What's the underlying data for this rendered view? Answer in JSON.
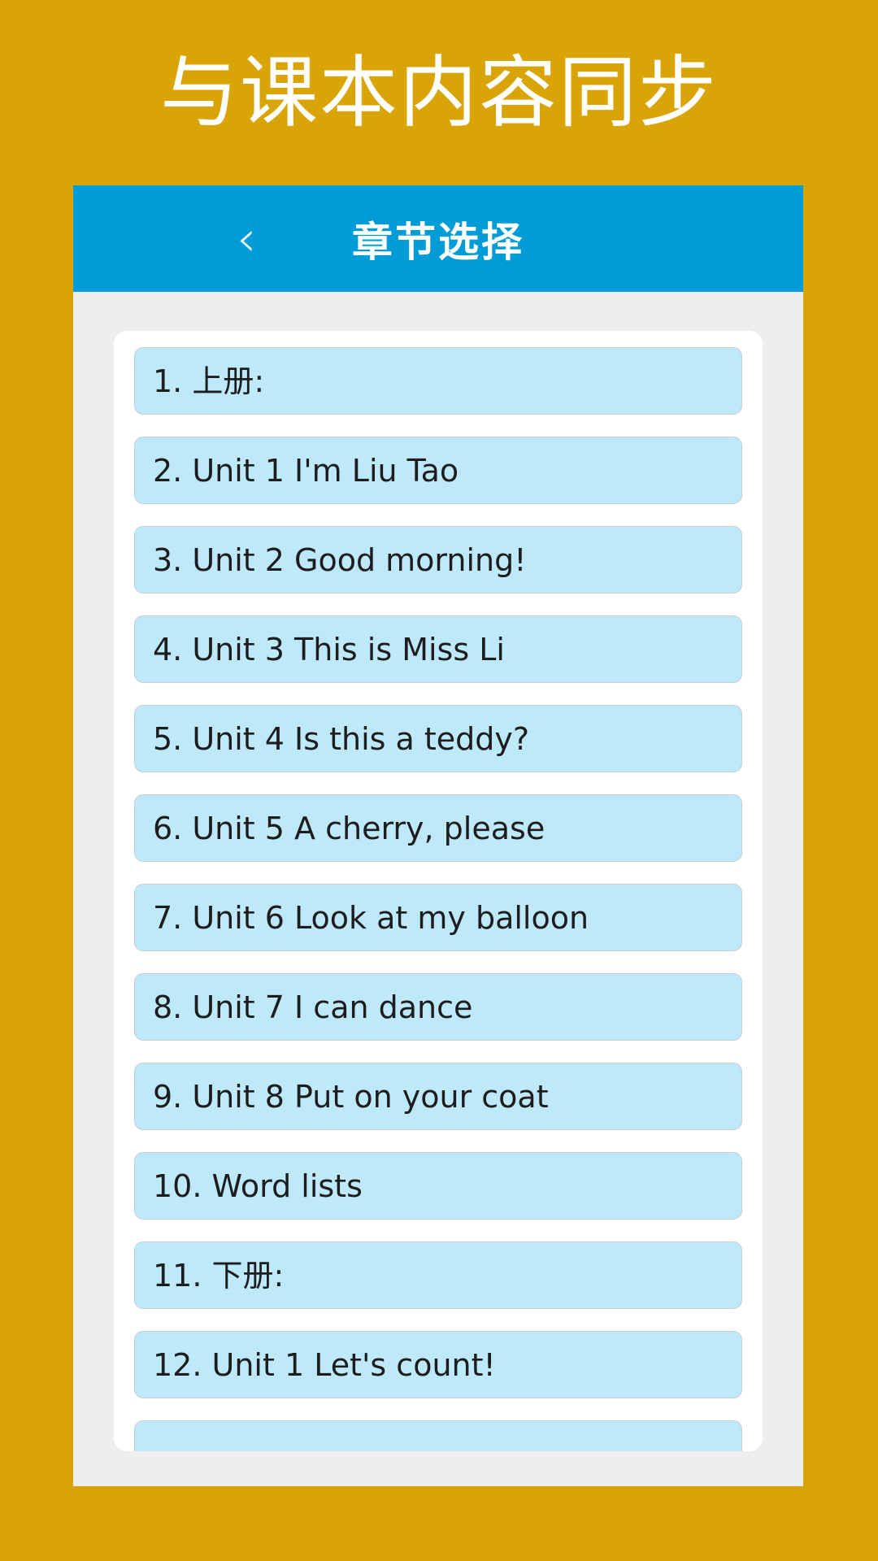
{
  "promo": {
    "heading": "与课本内容同步"
  },
  "colors": {
    "page_background": "#d9a406",
    "app_bar": "#009cd7",
    "phone_background": "#eeeeee",
    "card": "#ffffff",
    "item_fill": "#bde9fb",
    "item_border": "#c9cdd0",
    "item_text": "#1d1d1d",
    "heading_text": "#ffffff"
  },
  "app_bar": {
    "title": "章节选择",
    "back_icon": "chevron-left-icon",
    "back_glyph": "‹"
  },
  "chapter_list": {
    "items": [
      {
        "label": "1. 上册:"
      },
      {
        "label": "2. Unit 1 I'm Liu Tao"
      },
      {
        "label": "3. Unit 2 Good morning!"
      },
      {
        "label": "4. Unit 3 This is Miss Li"
      },
      {
        "label": "5. Unit 4 Is this a teddy?"
      },
      {
        "label": "6. Unit 5 A cherry, please"
      },
      {
        "label": "7. Unit 6 Look at my balloon"
      },
      {
        "label": "8. Unit 7 I can dance"
      },
      {
        "label": "9. Unit 8 Put on your coat"
      },
      {
        "label": "10. Word lists"
      },
      {
        "label": "11. 下册:"
      },
      {
        "label": "12. Unit 1 Let's count!"
      },
      {
        "label": ""
      }
    ]
  }
}
